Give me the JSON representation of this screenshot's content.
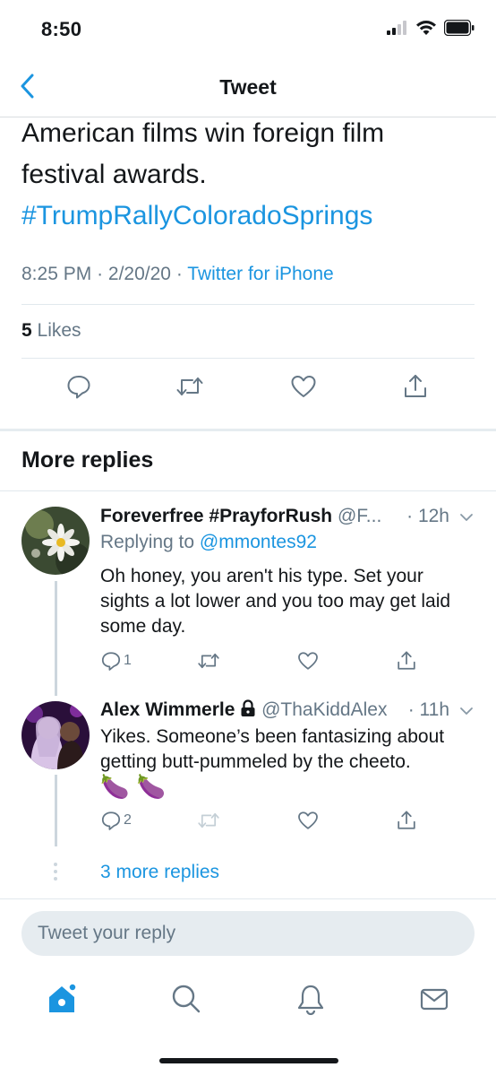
{
  "status_bar": {
    "time": "8:50"
  },
  "nav": {
    "title": "Tweet"
  },
  "tweet": {
    "text_line1": "American films win foreign film",
    "text_line2": "festival awards.",
    "hashtag": "#TrumpRallyColoradoSprings",
    "time": "8:25 PM",
    "date": "2/20/20",
    "source": "Twitter for iPhone",
    "likes_count": "5",
    "likes_label": "Likes"
  },
  "more_replies": {
    "title": "More replies"
  },
  "replies": [
    {
      "name": "Foreverfree #PrayforRush",
      "handle": "@F...",
      "time": "12h",
      "replying_label": "Replying to",
      "replying_to": "@mmontes92",
      "body": "Oh honey, you aren't his type.  Set your sights a lot lower and you too may get laid some day.",
      "reply_count": "1",
      "retweet_count": "",
      "like_count": ""
    },
    {
      "name": "Alex Wimmerle",
      "handle": "@ThaKiddAlex",
      "time": "11h",
      "body": "Yikes. Someone’s been fantasizing about getting butt-pummeled by the cheeto.",
      "emoji": "🍆 🍆",
      "reply_count": "2",
      "retweet_count": "",
      "like_count": ""
    }
  ],
  "more_replies_link": "3 more replies",
  "composer": {
    "placeholder": "Tweet your reply"
  },
  "colors": {
    "accent": "#1b95e0",
    "secondary_text": "#657786",
    "divider": "#e1e8ed"
  },
  "icons": {
    "nav": "chevron-left-icon",
    "actions": [
      "reply-icon",
      "retweet-icon",
      "like-icon",
      "share-icon"
    ],
    "tabs": [
      "home-icon",
      "search-icon",
      "notifications-icon",
      "messages-icon"
    ]
  }
}
